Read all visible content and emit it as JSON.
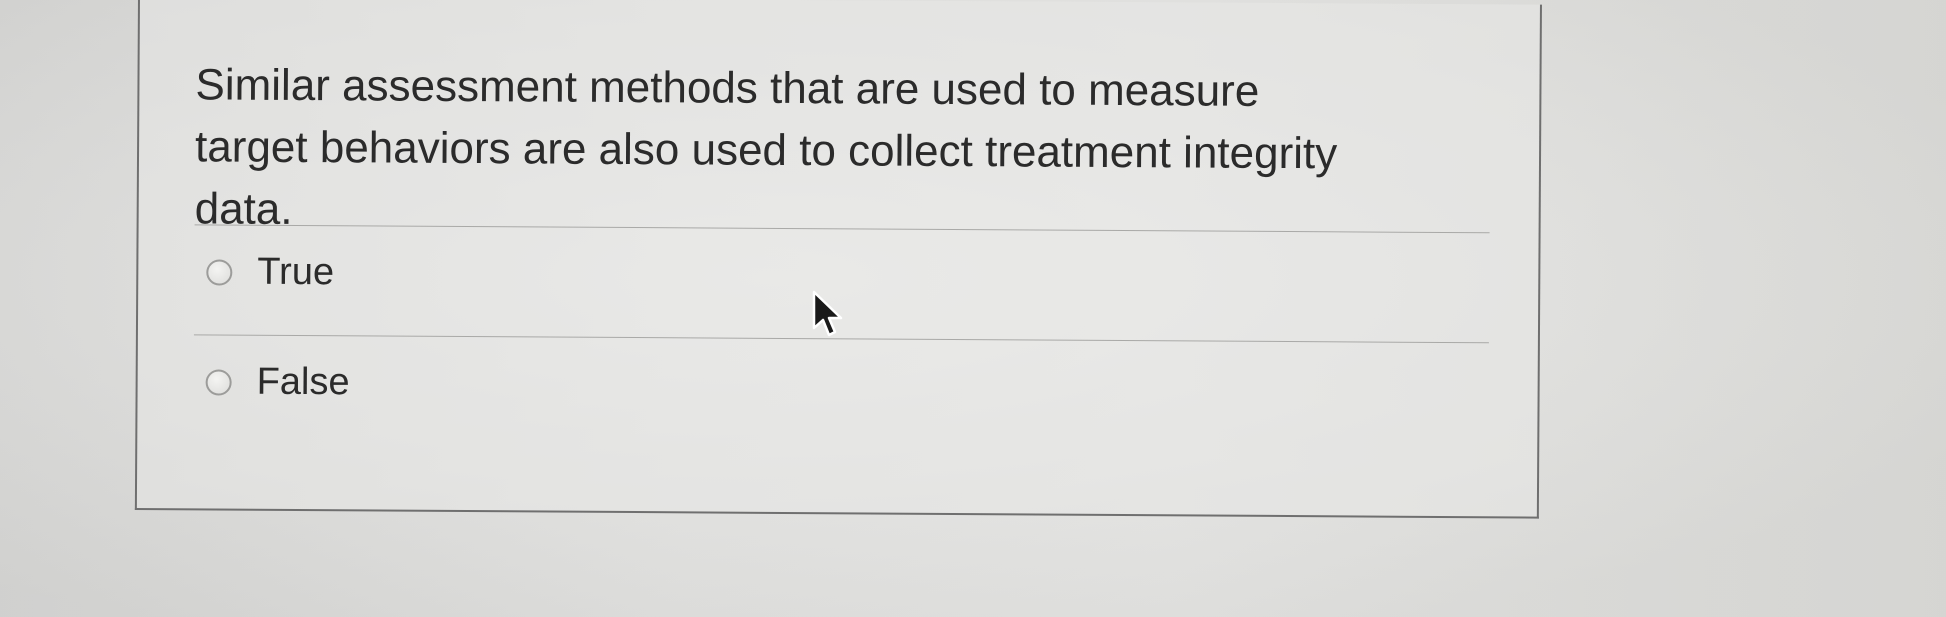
{
  "question": {
    "text": "Similar assessment methods that are used to measure target behaviors are also used to collect treatment integrity data."
  },
  "options": [
    {
      "label": "True",
      "selected": false
    },
    {
      "label": "False",
      "selected": false
    }
  ],
  "cursor": {
    "icon": "mouse-pointer-icon"
  }
}
